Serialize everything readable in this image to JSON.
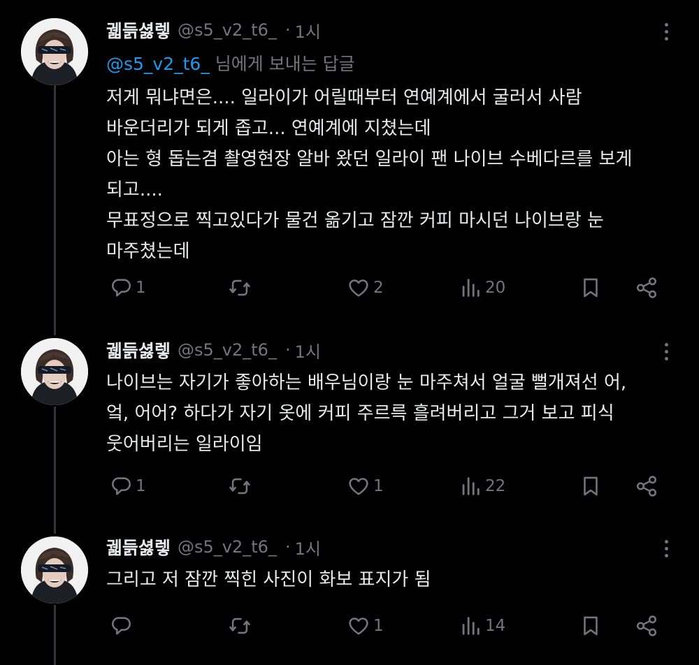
{
  "theme": {
    "background": "#000000",
    "text": "#e7e9ea",
    "muted": "#71767b",
    "accent": "#1d9bf0",
    "line": "#333639"
  },
  "tweets": [
    {
      "name": "궯듥셣렣",
      "handle": "@s5_v2_t6_",
      "dot": "·",
      "time": "1시",
      "reply_to": {
        "mention": "@s5_v2_t6_",
        "suffix": " 님에게 보내는 답글"
      },
      "lines": [
        "저게 뭐냐면은.... 일라이가 어릴때부터 연예계에서 굴러서 사람",
        "바운더리가 되게 좁고... 연예계에 지쳤는데",
        "아는 형 돕는겸 촬영현장 알바 왔던 일라이 팬 나이브 수베다르를 보게",
        "되고....",
        "무표정으로 찍고있다가 물건 옮기고 잠깐 커피 마시던 나이브랑 눈",
        "마주쳤는데"
      ],
      "replies": "1",
      "retweets": "",
      "likes": "2",
      "views": "20"
    },
    {
      "name": "궯듥셣렣",
      "handle": "@s5_v2_t6_",
      "dot": "·",
      "time": "1시",
      "lines": [
        "나이브는 자기가 좋아하는 배우님이랑 눈 마주쳐서 얼굴 뻘개져선 어,",
        "엌, 어어? 하다가 자기 옷에 커피 주르륵 흘려버리고 그거 보고 피식",
        "웃어버리는 일라이임"
      ],
      "replies": "1",
      "retweets": "",
      "likes": "1",
      "views": "22"
    },
    {
      "name": "궯듥셣렣",
      "handle": "@s5_v2_t6_",
      "dot": "·",
      "time": "1시",
      "lines": [
        "그리고 저 잠깐 찍힌 사진이 화보 표지가 됨"
      ],
      "replies": "",
      "retweets": "",
      "likes": "1",
      "views": "14"
    }
  ],
  "icons": {
    "reply": "reply-bubble-icon",
    "retweet": "retweet-icon",
    "like": "heart-icon",
    "views": "views-bars-icon",
    "bookmark": "bookmark-icon",
    "share": "share-icon",
    "more": "more-dots-icon",
    "avatar": "blindfolded-man-avatar"
  }
}
